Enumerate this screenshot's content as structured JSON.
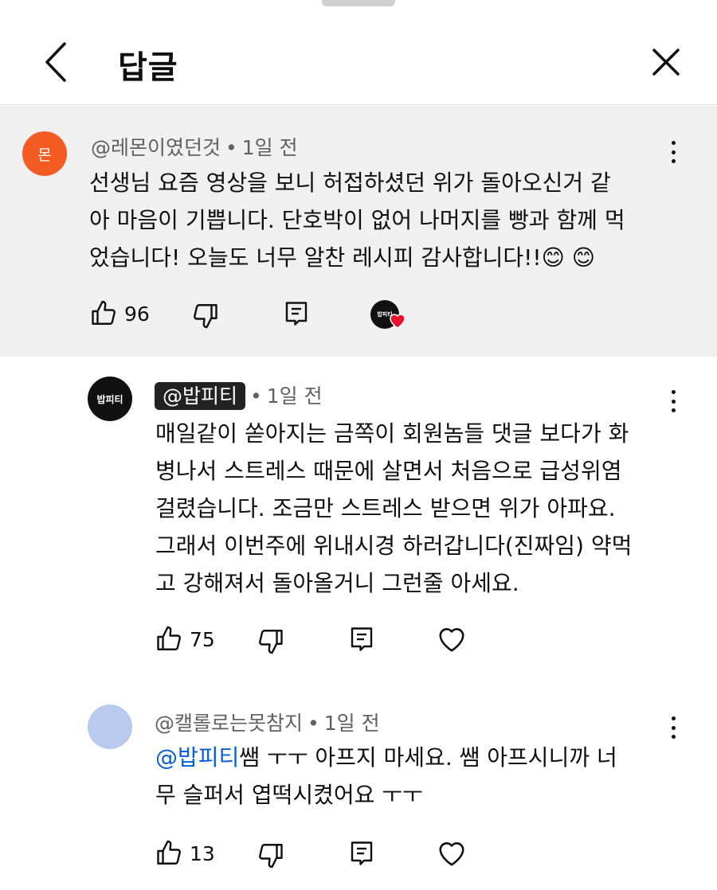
{
  "header": {
    "title": "답글"
  },
  "parent_comment": {
    "avatar_text": "몬",
    "author": "@레몬이였던것",
    "time": "1일 전",
    "lines": [
      "선생님 요즘 영상을 보니 허접하셨던 위가 돌아오신거 같",
      "아 마음이 기쁩니다. 단호박이 없어 나머지를 빵과 함께 먹",
      "었습니다! 오늘도 너무 알찬 레시피 감사합니다!!😊 😊"
    ],
    "likes": "96",
    "creator_heart_avatar_text": "밥피티"
  },
  "replies": [
    {
      "avatar_text": "밥피티",
      "author": "@밥피티",
      "time": "1일 전",
      "lines": [
        "매일같이 쏟아지는 금쪽이 회원놈들 댓글 보다가 화",
        "병나서 스트레스 때문에 살면서 처음으로 급성위염",
        "걸렸습니다. 조금만 스트레스 받으면 위가 아파요.",
        "그래서 이번주에 위내시경 하러갑니다(진짜임) 약먹",
        "고 강해져서 돌아올거니 그런줄 아세요."
      ],
      "likes": "75"
    },
    {
      "author": "@캘롤로는못참지",
      "time": "1일 전",
      "mention": "@밥피티",
      "line1_rest": "쌤 ㅜㅜ 아프지 마세요. 쌤 아프시니까 너",
      "line2": "무 슬퍼서 엽떡시켰어요 ㅜㅜ",
      "likes": "13"
    }
  ],
  "icons": {
    "back": "chevron-left-icon",
    "close": "close-icon",
    "like": "thumbs-up-icon",
    "dislike": "thumbs-down-icon",
    "reply": "reply-comment-icon",
    "heart": "heart-icon",
    "more": "more-vertical-icon"
  },
  "colors": {
    "avatar_orange": "#f25c23",
    "mention_blue": "#065fd4",
    "heart_red": "#e8112d",
    "avatar_blue": "#b8cbef"
  }
}
